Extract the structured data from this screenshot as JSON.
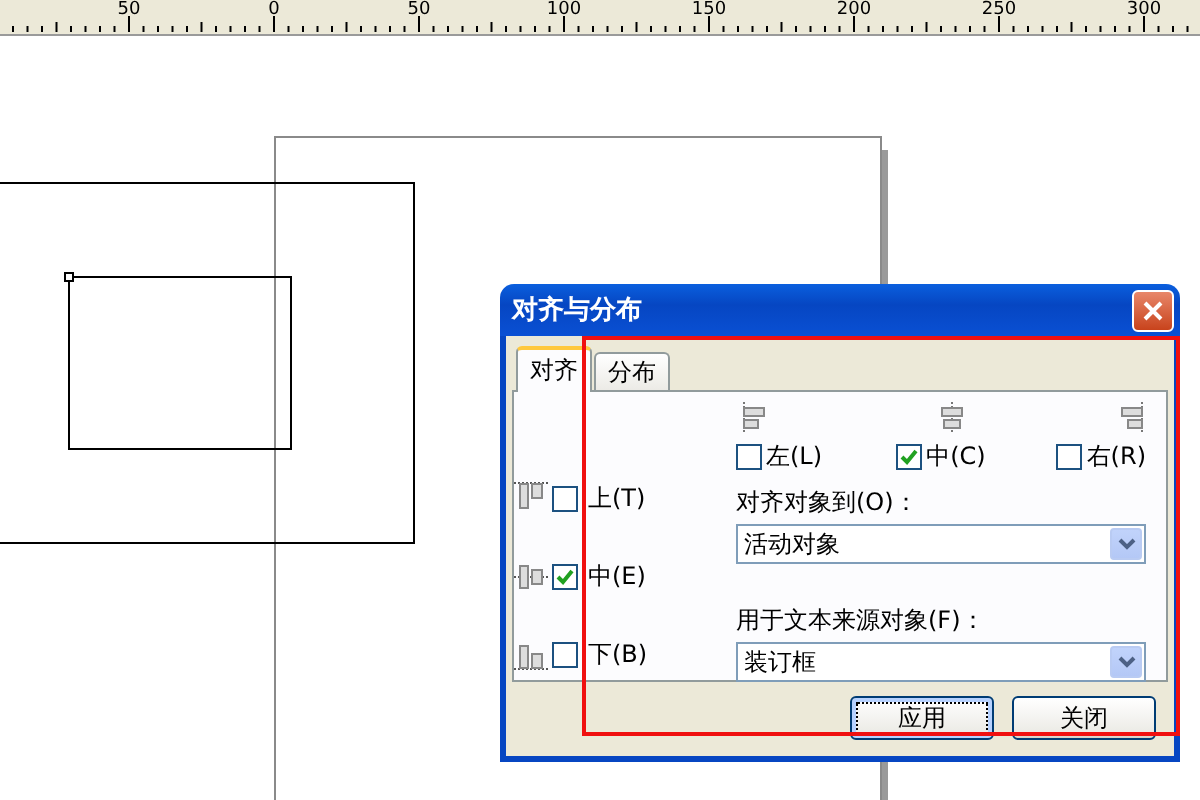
{
  "ruler": {
    "labels": [
      "50",
      "0",
      "50",
      "100",
      "150",
      "200",
      "250",
      "300"
    ]
  },
  "dialog": {
    "title": "对齐与分布",
    "tabs": [
      {
        "label": "对齐",
        "selected": true
      },
      {
        "label": "分布",
        "selected": false
      }
    ],
    "horizontal": [
      {
        "label": "左(L)",
        "checked": false
      },
      {
        "label": "中(C)",
        "checked": true
      },
      {
        "label": "右(R)",
        "checked": false
      }
    ],
    "vertical": [
      {
        "label": "上(T)",
        "checked": false
      },
      {
        "label": "中(E)",
        "checked": true
      },
      {
        "label": "下(B)",
        "checked": false
      }
    ],
    "align_to": {
      "label": "对齐对象到(O)：",
      "value": "活动对象"
    },
    "text_source": {
      "label": "用于文本来源对象(F)：",
      "value": "装订框"
    },
    "buttons": [
      {
        "label": "应用",
        "focused": true
      },
      {
        "label": "关闭",
        "focused": false
      }
    ]
  }
}
